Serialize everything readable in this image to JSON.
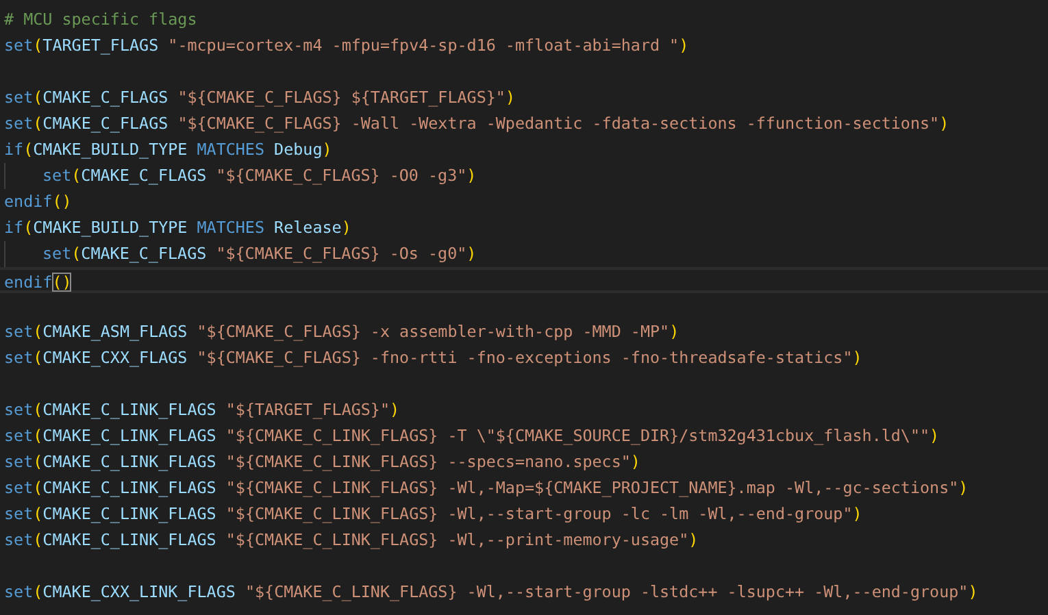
{
  "editor": {
    "lines": [
      {
        "kind": "code",
        "tokens": [
          {
            "kind": "comment",
            "text": "# MCU specific flags"
          }
        ]
      },
      {
        "kind": "code",
        "tokens": [
          {
            "kind": "keyword",
            "text": "set"
          },
          {
            "kind": "paren",
            "text": "("
          },
          {
            "kind": "plain",
            "text": "TARGET_FLAGS "
          },
          {
            "kind": "string",
            "text": "\"-mcpu=cortex-m4 -mfpu=fpv4-sp-d16 -mfloat-abi=hard \""
          },
          {
            "kind": "paren",
            "text": ")"
          }
        ]
      },
      {
        "kind": "blank"
      },
      {
        "kind": "code",
        "tokens": [
          {
            "kind": "keyword",
            "text": "set"
          },
          {
            "kind": "paren",
            "text": "("
          },
          {
            "kind": "plain",
            "text": "CMAKE_C_FLAGS "
          },
          {
            "kind": "string",
            "text": "\"${CMAKE_C_FLAGS} ${TARGET_FLAGS}\""
          },
          {
            "kind": "paren",
            "text": ")"
          }
        ]
      },
      {
        "kind": "code",
        "tokens": [
          {
            "kind": "keyword",
            "text": "set"
          },
          {
            "kind": "paren",
            "text": "("
          },
          {
            "kind": "plain",
            "text": "CMAKE_C_FLAGS "
          },
          {
            "kind": "string",
            "text": "\"${CMAKE_C_FLAGS} -Wall -Wextra -Wpedantic -fdata-sections -ffunction-sections\""
          },
          {
            "kind": "paren",
            "text": ")"
          }
        ]
      },
      {
        "kind": "code",
        "tokens": [
          {
            "kind": "keyword",
            "text": "if"
          },
          {
            "kind": "paren",
            "text": "("
          },
          {
            "kind": "plain",
            "text": "CMAKE_BUILD_TYPE "
          },
          {
            "kind": "keyword",
            "text": "MATCHES"
          },
          {
            "kind": "plain",
            "text": " Debug"
          },
          {
            "kind": "paren",
            "text": ")"
          }
        ]
      },
      {
        "kind": "code",
        "indented": true,
        "tokens": [
          {
            "kind": "keyword",
            "text": "set"
          },
          {
            "kind": "paren",
            "text": "("
          },
          {
            "kind": "plain",
            "text": "CMAKE_C_FLAGS "
          },
          {
            "kind": "string",
            "text": "\"${CMAKE_C_FLAGS} -O0 -g3\""
          },
          {
            "kind": "paren",
            "text": ")"
          }
        ]
      },
      {
        "kind": "code",
        "tokens": [
          {
            "kind": "keyword",
            "text": "endif"
          },
          {
            "kind": "paren",
            "text": "()"
          }
        ]
      },
      {
        "kind": "code",
        "tokens": [
          {
            "kind": "keyword",
            "text": "if"
          },
          {
            "kind": "paren",
            "text": "("
          },
          {
            "kind": "plain",
            "text": "CMAKE_BUILD_TYPE "
          },
          {
            "kind": "keyword",
            "text": "MATCHES"
          },
          {
            "kind": "plain",
            "text": " Release"
          },
          {
            "kind": "paren",
            "text": ")"
          }
        ]
      },
      {
        "kind": "code",
        "indented": true,
        "tokens": [
          {
            "kind": "keyword",
            "text": "set"
          },
          {
            "kind": "paren",
            "text": "("
          },
          {
            "kind": "plain",
            "text": "CMAKE_C_FLAGS "
          },
          {
            "kind": "string",
            "text": "\"${CMAKE_C_FLAGS} -Os -g0\""
          },
          {
            "kind": "paren",
            "text": ")"
          }
        ]
      },
      {
        "kind": "code",
        "current": true,
        "tokens": [
          {
            "kind": "keyword",
            "text": "endif"
          },
          {
            "kind": "matched",
            "text": "()"
          }
        ]
      },
      {
        "kind": "blank"
      },
      {
        "kind": "code",
        "tokens": [
          {
            "kind": "keyword",
            "text": "set"
          },
          {
            "kind": "paren",
            "text": "("
          },
          {
            "kind": "plain",
            "text": "CMAKE_ASM_FLAGS "
          },
          {
            "kind": "string",
            "text": "\"${CMAKE_C_FLAGS} -x assembler-with-cpp -MMD -MP\""
          },
          {
            "kind": "paren",
            "text": ")"
          }
        ]
      },
      {
        "kind": "code",
        "tokens": [
          {
            "kind": "keyword",
            "text": "set"
          },
          {
            "kind": "paren",
            "text": "("
          },
          {
            "kind": "plain",
            "text": "CMAKE_CXX_FLAGS "
          },
          {
            "kind": "string",
            "text": "\"${CMAKE_C_FLAGS} -fno-rtti -fno-exceptions -fno-threadsafe-statics\""
          },
          {
            "kind": "paren",
            "text": ")"
          }
        ]
      },
      {
        "kind": "blank"
      },
      {
        "kind": "code",
        "tokens": [
          {
            "kind": "keyword",
            "text": "set"
          },
          {
            "kind": "paren",
            "text": "("
          },
          {
            "kind": "plain",
            "text": "CMAKE_C_LINK_FLAGS "
          },
          {
            "kind": "string",
            "text": "\"${TARGET_FLAGS}\""
          },
          {
            "kind": "paren",
            "text": ")"
          }
        ]
      },
      {
        "kind": "code",
        "tokens": [
          {
            "kind": "keyword",
            "text": "set"
          },
          {
            "kind": "paren",
            "text": "("
          },
          {
            "kind": "plain",
            "text": "CMAKE_C_LINK_FLAGS "
          },
          {
            "kind": "string",
            "text": "\"${CMAKE_C_LINK_FLAGS} -T \\\"${CMAKE_SOURCE_DIR}/stm32g431cbux_flash.ld\\\"\""
          },
          {
            "kind": "paren",
            "text": ")"
          }
        ]
      },
      {
        "kind": "code",
        "tokens": [
          {
            "kind": "keyword",
            "text": "set"
          },
          {
            "kind": "paren",
            "text": "("
          },
          {
            "kind": "plain",
            "text": "CMAKE_C_LINK_FLAGS "
          },
          {
            "kind": "string",
            "text": "\"${CMAKE_C_LINK_FLAGS} --specs=nano.specs\""
          },
          {
            "kind": "paren",
            "text": ")"
          }
        ]
      },
      {
        "kind": "code",
        "tokens": [
          {
            "kind": "keyword",
            "text": "set"
          },
          {
            "kind": "paren",
            "text": "("
          },
          {
            "kind": "plain",
            "text": "CMAKE_C_LINK_FLAGS "
          },
          {
            "kind": "string",
            "text": "\"${CMAKE_C_LINK_FLAGS} -Wl,-Map=${CMAKE_PROJECT_NAME}.map -Wl,--gc-sections\""
          },
          {
            "kind": "paren",
            "text": ")"
          }
        ]
      },
      {
        "kind": "code",
        "tokens": [
          {
            "kind": "keyword",
            "text": "set"
          },
          {
            "kind": "paren",
            "text": "("
          },
          {
            "kind": "plain",
            "text": "CMAKE_C_LINK_FLAGS "
          },
          {
            "kind": "string",
            "text": "\"${CMAKE_C_LINK_FLAGS} -Wl,--start-group -lc -lm -Wl,--end-group\""
          },
          {
            "kind": "paren",
            "text": ")"
          }
        ]
      },
      {
        "kind": "code",
        "tokens": [
          {
            "kind": "keyword",
            "text": "set"
          },
          {
            "kind": "paren",
            "text": "("
          },
          {
            "kind": "plain",
            "text": "CMAKE_C_LINK_FLAGS "
          },
          {
            "kind": "string",
            "text": "\"${CMAKE_C_LINK_FLAGS} -Wl,--print-memory-usage\""
          },
          {
            "kind": "paren",
            "text": ")"
          }
        ]
      },
      {
        "kind": "blank"
      },
      {
        "kind": "code",
        "tokens": [
          {
            "kind": "keyword",
            "text": "set"
          },
          {
            "kind": "paren",
            "text": "("
          },
          {
            "kind": "plain",
            "text": "CMAKE_CXX_LINK_FLAGS "
          },
          {
            "kind": "string",
            "text": "\"${CMAKE_C_LINK_FLAGS} -Wl,--start-group -lstdc++ -lsupc++ -Wl,--end-group\""
          },
          {
            "kind": "paren",
            "text": ")"
          }
        ]
      }
    ]
  }
}
